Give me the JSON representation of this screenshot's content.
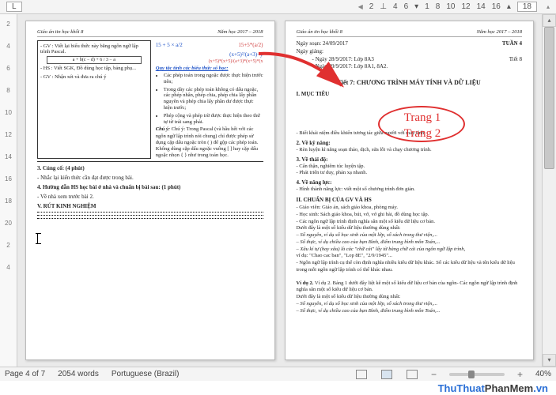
{
  "topbar": {
    "L": "L",
    "p2": "2",
    "p4": "4",
    "p6": "6",
    "s1": "1",
    "p8": "8",
    "p10": "10",
    "p12": "12",
    "p14": "14",
    "p16": "16",
    "box": "18"
  },
  "ruler": [
    "2",
    "4",
    "6",
    "8",
    "10",
    "12",
    "14",
    "16",
    "18",
    "20",
    "2",
    "4"
  ],
  "pageHeader": {
    "left": "Giáo án tin học khối 8",
    "right": "Năm học 2017 – 2018"
  },
  "leftPage": {
    "gv1": "- GV : Viết lại biểu thức này bằng ngôn ngữ lập trình Pascal.",
    "frac": "a + b(c − d) + 6 / 3 − a",
    "gv2": "- HS : Viết SGK, Đồ dùng học tập, bảng phụ...",
    "gv3": "- GV : Nhận xét và đưa ra chú ý",
    "m1": "15 + 5 × a/2",
    "m2": "15+5*(a/2)",
    "m3": "(x+5)²/(a+3)−y",
    "m4": "(x+5)*(x+5)/(a+3)*(x+5)*(x",
    "mtitle": "Quy tắc tính các biểu thức số học:",
    "b1": "Các phép toán trong ngoặc được thực hiện trước tiên;",
    "b2": "Trong dãy các phép toán không có dấu ngoặc, các phép nhân, phép chia, phép chia lấy phần nguyên và phép chia lấy phần dư được thực hiện trước;",
    "b3": "Phép cộng và phép trừ được thực hiện theo thứ tự từ trái sang phải.",
    "note": "Chú ý: Trong Pascal (và hầu hết với các ngôn ngữ lập trình nói chung) chỉ được phép sử dụng cặp dấu ngoặc tròn ( ) để gộp các phép toán. Không dùng cặp dấu ngoặc vuông [ ] hay cặp dấu ngoặc nhọn { } như trong toán học.",
    "s3": "3. Củng cố: (4 phút)",
    "s3a": "- Nhắc lại kiến thức cần đạt được trong bài.",
    "s4": "4. Hướng dẫn HS học bài ở nhà và chuẩn bị bài sau: (1 phút)",
    "s4a": "- Về nhà xem trước bài 2.",
    "s5": "V. RÚT KINH NGHIỆM"
  },
  "rightPage": {
    "ngaysoan": "Ngày soạn: 24/09/2017",
    "tuan": "TUẦN 4",
    "ngaygiang": "Ngày giảng:",
    "d1": "- Ngày 28/9/2017: Lớp 8A3",
    "tiet8": "Tiết 8",
    "d2": "- Ngày 29/9/2017: Lớp 8A1, 8A2.",
    "title": "Tiết 7: CHƯƠNG TRÌNH MÁY TÍNH VÀ DỮ LIỆU",
    "h_muc": "I. MỤC TIÊU",
    "p1": "- Biết khái niệm điều khiển tương tác giữa người với máy tính.",
    "h_kn": "2. Về kỹ năng:",
    "p2": "- Rèn luyện kĩ năng soạn thảo, dịch, sửa lỗi và chạy chương trình.",
    "h_td": "3. Về thái độ:",
    "p3": "- Cẩn thận, nghiêm túc luyện tập.",
    "p3b": "- Phát triển tư duy, phản xạ nhanh.",
    "h_nl": "4. Về năng lực:",
    "p4": "- Hình thành năng lực: viết một số chương trình đơn giản.",
    "h_cb": "II. CHUẨN BỊ CỦA GV VÀ HS",
    "p5": "- Giáo viên: Giáo án, sách giáo khoa, phòng máy.",
    "p6": "- Học sinh: Sách giáo khoa, bút, vở, vở ghi bài, đồ dùng học tập.",
    "p7": "- Các ngôn ngữ lập trình định nghĩa sẵn một số kiểu dữ liệu cơ bản.",
    "p8": "Dưới đây là một số kiểu dữ liệu thường dùng nhất:",
    "p9": "– Số nguyên, ví dụ số học sinh của một lớp, số sách trong thư viện,...",
    "p10": "– Số thực, ví dụ chiều cao của bạn Bình, điểm trung bình môn Toán,...",
    "p11": "– Xâu kí tự (hay xâu) là các \"chữ cái\" lấy từ bảng chữ cái của ngôn ngữ lập trình,",
    "p12": "ví dụ: \"Chao cac ban\", \"Lop 8E\", \"2/9/1945\"...",
    "p13": "- Ngôn ngữ lập trình cụ thể còn định nghĩa nhiều kiểu dữ liệu khác. Số các kiểu dữ liệu và tên kiểu dữ liệu trong mỗi ngôn ngữ lập trình có thể khác nhau.",
    "vd": "Ví dụ 2. Bảng 1 dưới đây liệt kê một số kiểu dữ liệu cơ bản của ngôn- Các ngôn ngữ lập trình định nghĩa sẵn một số kiểu dữ liệu cơ bản.",
    "p14": "Dưới đây là một số kiểu dữ liệu thường dùng nhất:",
    "p15": "– Số nguyên, ví dụ số học sinh của một lớp, số sách trong thư viện,...",
    "p16": "– Số thực, ví dụ chiều cao của bạn Bình, điểm trung bình môn Toán,..."
  },
  "anno": {
    "t1": "Trang 1",
    "t2": "Trang 2"
  },
  "status": {
    "page": "Page 4 of 7",
    "words": "2054 words",
    "lang": "Portuguese (Brazil)",
    "zoom": "40%"
  },
  "watermark": {
    "a": "ThuThuat",
    "b": "PhanMem",
    "c": ".vn"
  }
}
